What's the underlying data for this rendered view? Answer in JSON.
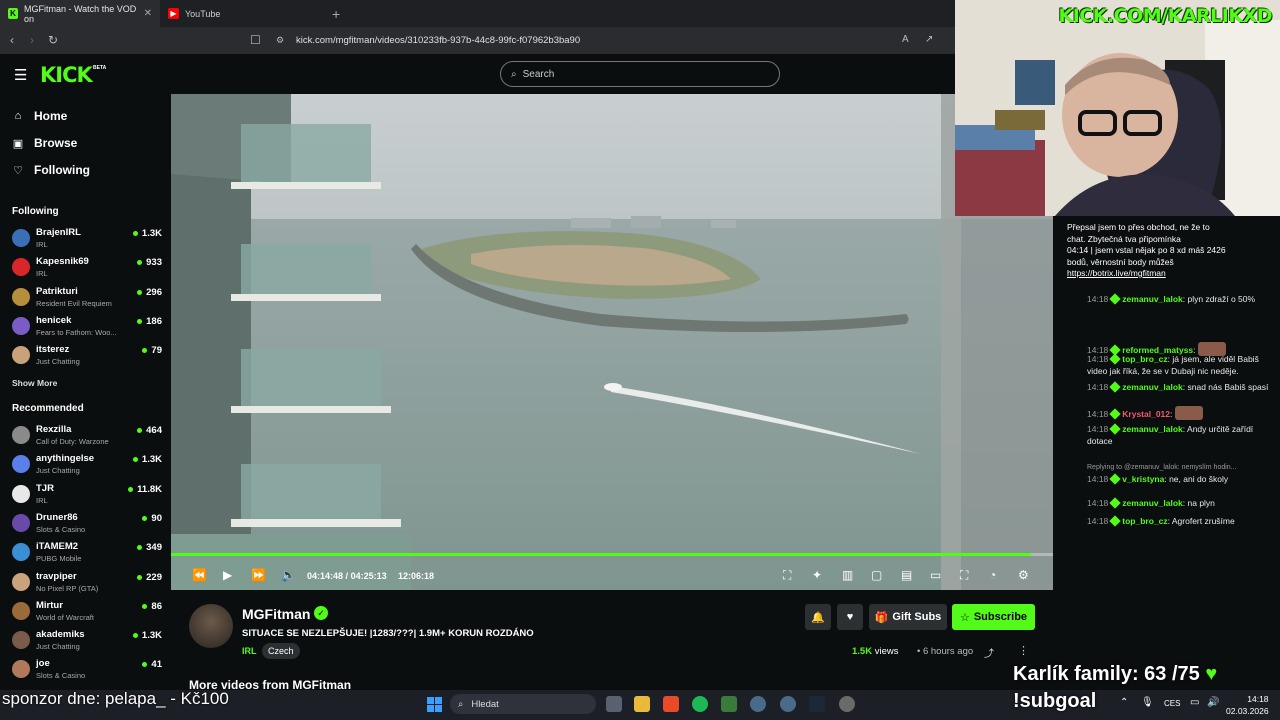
{
  "browser": {
    "tabs": [
      {
        "title": "MGFitman - Watch the VOD on",
        "active": true
      },
      {
        "title": "YouTube",
        "active": false
      }
    ],
    "new_tab": "+",
    "url": "kick.com/mgfitman/videos/310233fb-937b-44c8-99fc-f07962b3ba90"
  },
  "header": {
    "logo": "KICK",
    "beta": "BETA",
    "search_placeholder": "Search"
  },
  "sidebar": {
    "nav": [
      {
        "label": "Home",
        "icon": "home-icon"
      },
      {
        "label": "Browse",
        "icon": "browse-icon"
      },
      {
        "label": "Following",
        "icon": "heart-icon"
      }
    ],
    "following_title": "Following",
    "following": [
      {
        "name": "BrajenIRL",
        "category": "IRL",
        "viewers": "1.3K",
        "color": "#3b6fb5"
      },
      {
        "name": "Kapesnik69",
        "category": "IRL",
        "viewers": "933",
        "color": "#d9262b"
      },
      {
        "name": "Patrikturi",
        "category": "Resident Evil Requiem",
        "viewers": "296",
        "color": "#b58f3b"
      },
      {
        "name": "henicek",
        "category": "Fears to Fathom: Woo...",
        "viewers": "186",
        "color": "#7b5cc4"
      },
      {
        "name": "itsterez",
        "category": "Just Chatting",
        "viewers": "79",
        "color": "#caa27a"
      }
    ],
    "show_more": "Show More",
    "recommended_title": "Recommended",
    "recommended": [
      {
        "name": "Rexzilla",
        "category": "Call of Duty: Warzone",
        "viewers": "464",
        "color": "#8a8a8a"
      },
      {
        "name": "anythingelse",
        "category": "Just Chatting",
        "viewers": "1.3K",
        "color": "#5b7fe8"
      },
      {
        "name": "TJR",
        "category": "IRL",
        "viewers": "11.8K",
        "color": "#e8e8e8"
      },
      {
        "name": "Druner86",
        "category": "Slots & Casino",
        "viewers": "90",
        "color": "#6a4aa8"
      },
      {
        "name": "iTAMEM2",
        "category": "PUBG Mobile",
        "viewers": "349",
        "color": "#3a8fd4"
      },
      {
        "name": "travpiper",
        "category": "No Pixel RP (GTA)",
        "viewers": "229",
        "color": "#c9a27e"
      },
      {
        "name": "Mirtur",
        "category": "World of Warcraft",
        "viewers": "86",
        "color": "#9a6a3a"
      },
      {
        "name": "akademiks",
        "category": "Just Chatting",
        "viewers": "1.3K",
        "color": "#7a5a4a"
      },
      {
        "name": "joe",
        "category": "Slots & Casino",
        "viewers": "41",
        "color": "#b07a5a"
      }
    ]
  },
  "player": {
    "progress": 0.9747,
    "position": "04:14:48",
    "separator": "/",
    "duration": "04:25:13",
    "elapsed": "12:06:18"
  },
  "video_info": {
    "channel": "MGFitman",
    "title": "SITUACE SE NEZLEPŠUJE! |1283/???| 1.9M+ KORUN ROZDÁNO",
    "category": "IRL",
    "tag": "Czech",
    "gift_label": "Gift Subs",
    "subscribe_label": "Subscribe",
    "views": "1.5K",
    "views_label": "views",
    "age": "6 hours ago",
    "more_videos": "More videos from MGFitman"
  },
  "chat": {
    "pinned_lines": [
      "Přepsal jsem to přes obchod, ne že to",
      "chat. Zbytečná tva připomínka",
      "04:14 | jsem vstal nějak po 8 xd máš 2426",
      "bodů, věrnostní body můžeš",
      "https://botrix.live/mgfitman"
    ],
    "messages": [
      {
        "time": "14:18",
        "user": "zemanuv_lalok",
        "text": "plyn zdraží o 50%",
        "color": "green"
      },
      {
        "time": "14:18",
        "user": "reformed_matyss",
        "text": "",
        "color": "green"
      },
      {
        "time": "14:18",
        "user": "top_bro_cz",
        "text": "já jsem, ale viděl Babiš video jak říká, že se v Dubaji nic neděje.",
        "color": "green"
      },
      {
        "time": "14:18",
        "user": "zemanuv_lalok",
        "text": "snad nás Babiš spasí",
        "color": "green"
      },
      {
        "time": "14:18",
        "user": "Krystal_012",
        "text": "",
        "color": "red"
      },
      {
        "time": "14:18",
        "user": "zemanuv_lalok",
        "text": "Andy určitě zařídí dotace",
        "color": "green"
      },
      {
        "time": "14:18",
        "user": "v_kristyna",
        "text": "ne, ani do školy",
        "color": "green",
        "reply": "Replying to @zemanuv_lalok: nemyslím hodin..."
      },
      {
        "time": "14:18",
        "user": "zemanuv_lalok",
        "text": "na plyn",
        "color": "green"
      },
      {
        "time": "14:18",
        "user": "top_bro_cz",
        "text": "Agrofert zrušíme",
        "color": "green"
      }
    ]
  },
  "overlay": {
    "kick_link": "KICK.COM/KARLIKXD",
    "sponsor": "sponzor dne: pelapa_ - Kč100",
    "goal": "Karlík family: 63 /75",
    "goal_heart": "♥",
    "subgoal": "!subgoal"
  },
  "taskbar": {
    "search_placeholder": "Hledat",
    "lang": "CES",
    "time": "14:18",
    "date": "02.03.2026"
  },
  "colors": {
    "brand": "#53fc18",
    "background": "#0b0e0f"
  }
}
